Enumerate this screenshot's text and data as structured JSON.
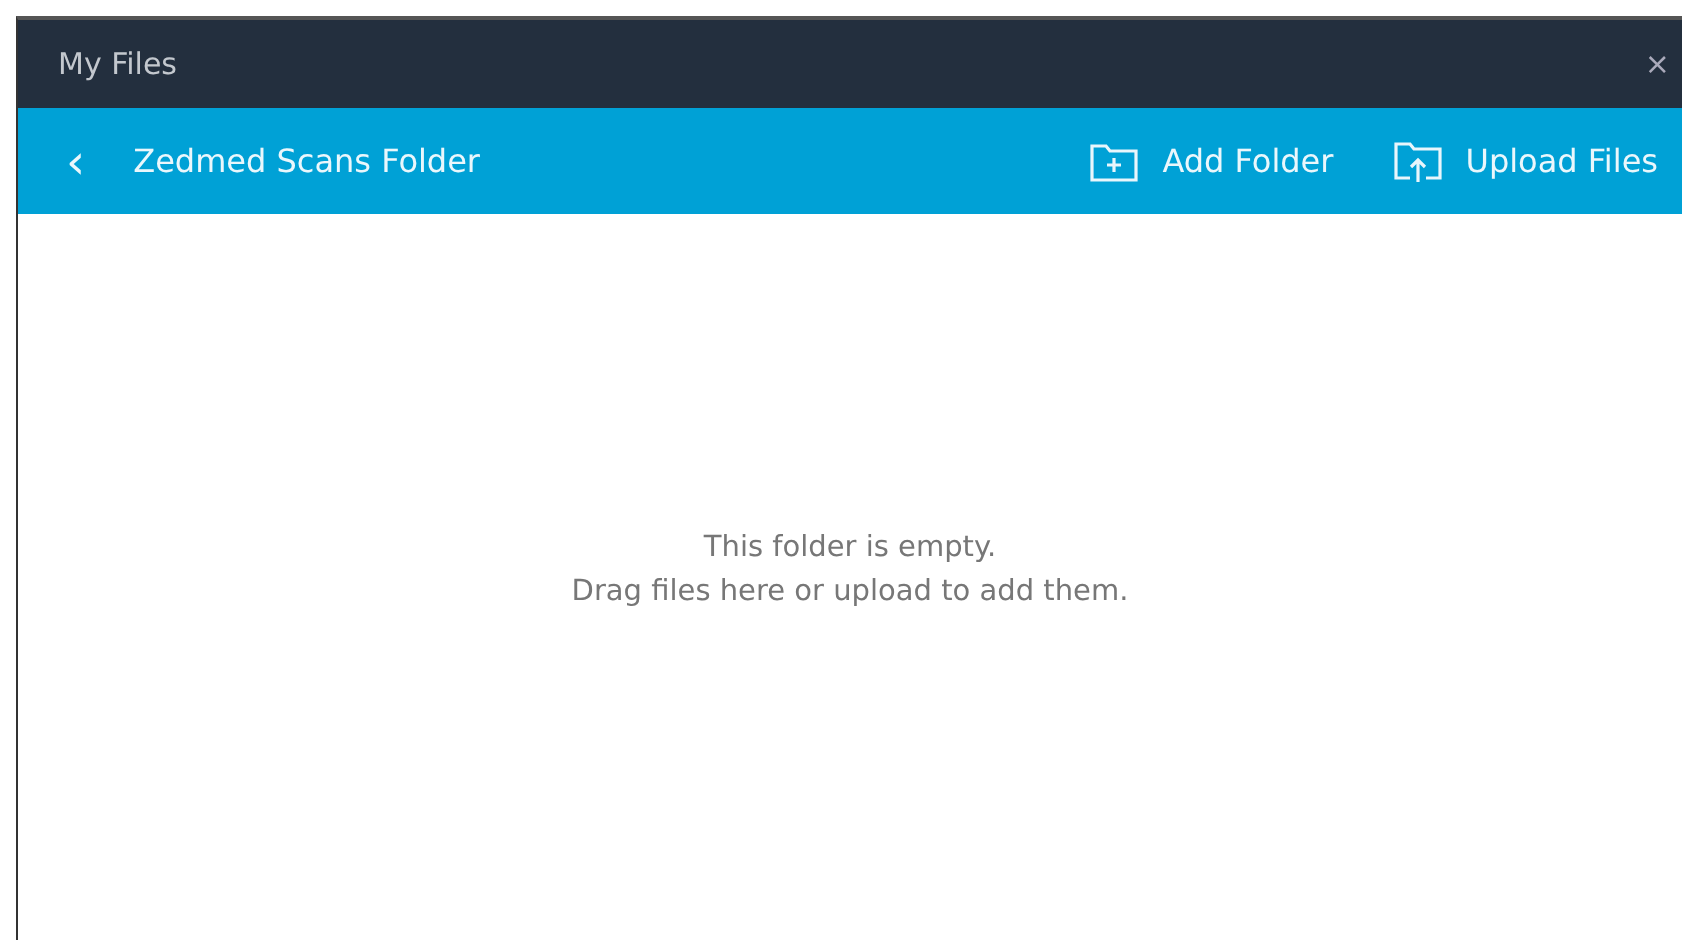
{
  "window": {
    "title": "My Files",
    "close": "×"
  },
  "toolbar": {
    "back": "‹",
    "folder_name": "Zedmed Scans Folder",
    "actions": [
      {
        "kind": "add_folder",
        "label": "Add Folder"
      },
      {
        "kind": "upload",
        "label": "Upload Files"
      }
    ]
  },
  "empty_state": {
    "lines": [
      "This folder is empty.",
      "Drag files here or upload to add them."
    ]
  }
}
